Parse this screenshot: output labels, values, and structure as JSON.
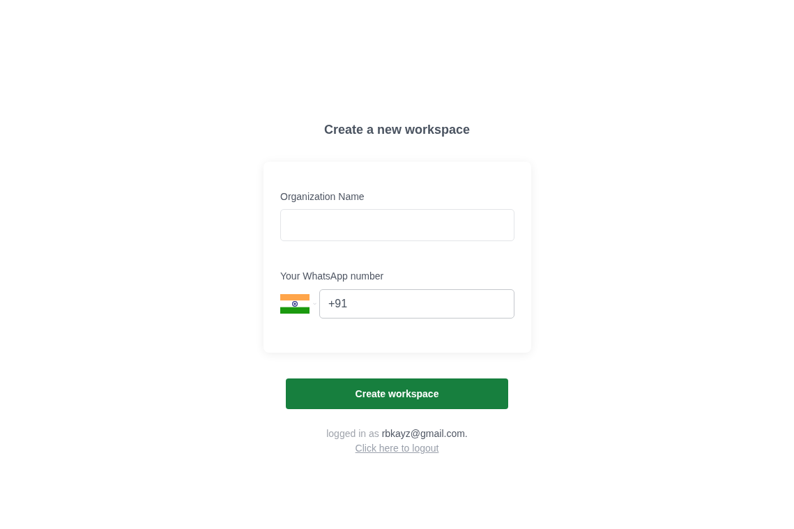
{
  "title": "Create a new workspace",
  "form": {
    "organization": {
      "label": "Organization Name"
    },
    "phone": {
      "label": "Your WhatsApp number",
      "value": "+91"
    }
  },
  "submit": {
    "label": "Create workspace"
  },
  "session": {
    "prefix": "logged in as",
    "email": "rbkayz@gmail.com.",
    "logout_link": "Click here to logout"
  }
}
